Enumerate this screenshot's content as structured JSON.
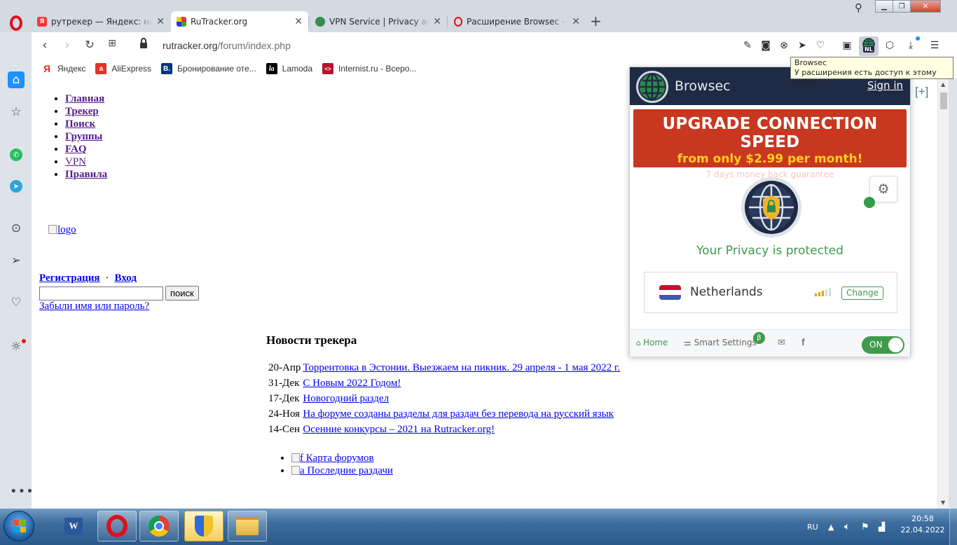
{
  "browser": {
    "tabs": [
      {
        "title": "рутрекер — Яндекс: нашё",
        "favicon": "yandex-icon",
        "active": false
      },
      {
        "title": "RuTracker.org",
        "favicon": "rutracker-icon",
        "active": true
      },
      {
        "title": "VPN Service | Privacy and S",
        "favicon": "globe-icon",
        "active": false
      },
      {
        "title": "Расширение Browsec - До",
        "favicon": "opera-icon",
        "active": false
      }
    ],
    "url_host": "rutracker.org",
    "url_path": "/forum/index.php",
    "bookmarks": [
      {
        "label": "Яндекс",
        "icon": "yandex-icon",
        "glyph": "Я",
        "color": "#e0301e"
      },
      {
        "label": "AliExpress",
        "icon": "aliexpress-icon",
        "glyph": "a",
        "color": "#e43225"
      },
      {
        "label": "Бронирование оте...",
        "icon": "booking-icon",
        "glyph": "B.",
        "color": "#003580"
      },
      {
        "label": "Lamoda",
        "icon": "lamoda-icon",
        "glyph": "la",
        "color": "#000000"
      },
      {
        "label": "Internist.ru - Всеро...",
        "icon": "internist-icon",
        "glyph": "<>",
        "color": "#b5162a"
      }
    ],
    "browsec_badge": "NL"
  },
  "tooltip": {
    "line1": "Browsec",
    "line2": "У расширения есть доступ к этому сайту"
  },
  "page": {
    "nav": [
      "Главная",
      "Трекер",
      "Поиск",
      "Группы",
      "FAQ",
      "VPN",
      "Правила"
    ],
    "logo_alt": "logo",
    "register": "Регистрация",
    "auth_sep": "·",
    "login": "Вход",
    "search_button": "поиск",
    "forgot": "Забыли имя или пароль?",
    "news_title": "Новости трекера",
    "news": [
      {
        "date": "20-Апр",
        "text": "Торрентовка в Эстонии. Выезжаем на пикник. 29 апреля - 1 мая 2022 г."
      },
      {
        "date": "31-Дек",
        "text": "С Новым 2022 Годом!"
      },
      {
        "date": "17-Дек",
        "text": "Новогодний раздел"
      },
      {
        "date": "24-Ноя",
        "text": "На форуме созданы разделы для раздач без перевода на русский язык"
      },
      {
        "date": "14-Сен",
        "text": "Осенние конкурсы – 2021 на Rutracker.org!"
      }
    ],
    "bottom_links": [
      {
        "alt": "f",
        "text": "Карта форумов"
      },
      {
        "alt": "a",
        "text": "Последние раздачи"
      }
    ],
    "plus_widget": "[+]"
  },
  "browsec": {
    "brand": "Browsec",
    "sign_in": "Sign in",
    "promo_title": "UPGRADE CONNECTION SPEED",
    "promo_price": "from only $2.99 per month!",
    "promo_note": "7 days money back guarantee",
    "status": "Your Privacy is protected",
    "country": "Netherlands",
    "change": "Change",
    "signal_bars_lit": 3,
    "signal_bars_total": 5,
    "footer": {
      "home": "Home",
      "smart_settings": "Smart Settings",
      "beta": "β",
      "toggle": "ON"
    },
    "colors": {
      "header": "#1f2a44",
      "promo": "#c8371f",
      "accent": "#3f9a4c",
      "price": "#ffd01f"
    }
  },
  "taskbar": {
    "lang": "RU",
    "time": "20:58",
    "date": "22.04.2022",
    "apps": [
      "word-icon",
      "opera-icon",
      "chrome-icon",
      "security-shield-icon",
      "file-explorer-icon"
    ]
  }
}
